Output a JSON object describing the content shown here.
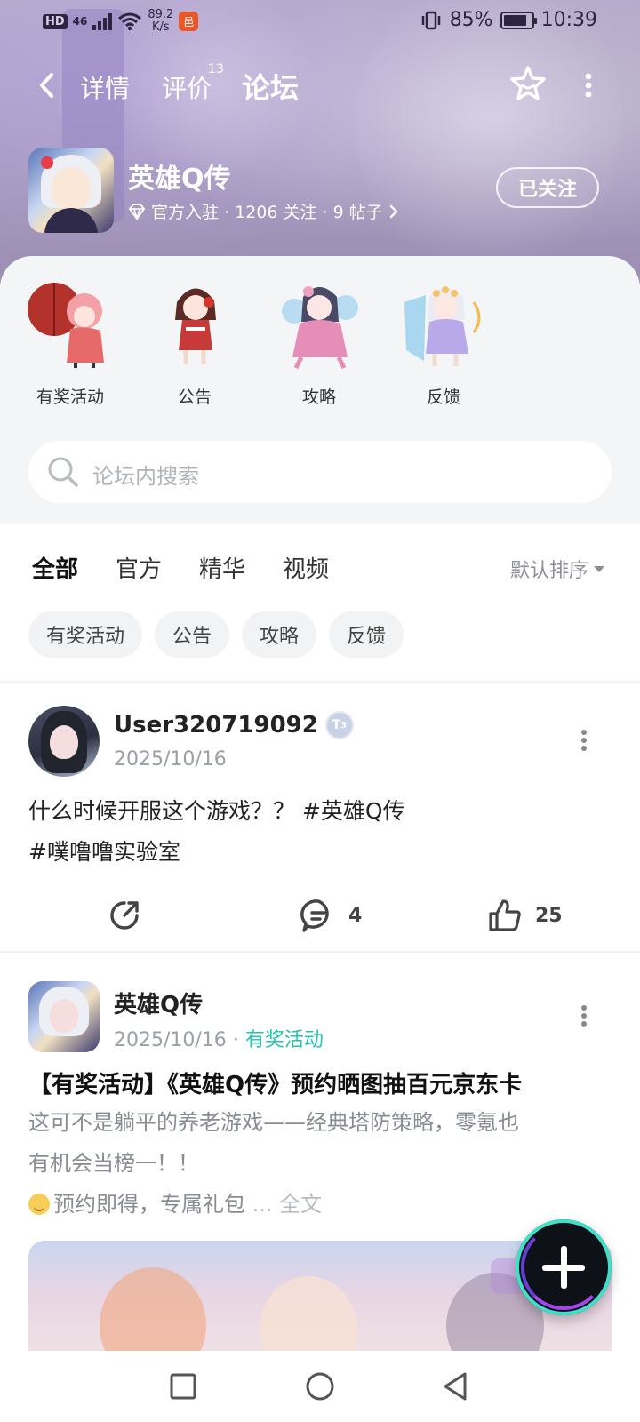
{
  "status_bar": {
    "network_type": "HD",
    "signal_label": "46",
    "speed_value": "89.2",
    "speed_unit": "K/s",
    "battery": "85%",
    "battery_level": 0.85,
    "time": "10:39"
  },
  "nav": {
    "tabs": [
      {
        "label": "详情"
      },
      {
        "label": "评价",
        "count": "13"
      },
      {
        "label": "论坛"
      }
    ],
    "active_tab": "论坛"
  },
  "game": {
    "title": "英雄Q传",
    "meta": "官方入驻 · 1206 关注 · 9 帖子",
    "follow_label": "已关注"
  },
  "quick_links": [
    {
      "label": "有奖活动"
    },
    {
      "label": "公告"
    },
    {
      "label": "攻略"
    },
    {
      "label": "反馈"
    }
  ],
  "search": {
    "placeholder": "论坛内搜索"
  },
  "filter_tabs": [
    {
      "label": "全部"
    },
    {
      "label": "官方"
    },
    {
      "label": "精华"
    },
    {
      "label": "视频"
    }
  ],
  "sort_label": "默认排序",
  "chips": [
    {
      "label": "有奖活动"
    },
    {
      "label": "公告"
    },
    {
      "label": "攻略"
    },
    {
      "label": "反馈"
    }
  ],
  "posts": [
    {
      "author": "User320719092",
      "level": "3",
      "date": "2025/10/16",
      "content_line1": "什么时候开服这个游戏？？ #英雄Q传",
      "content_line2": "#噗噜噜实验室",
      "comments": "4",
      "likes": "25"
    },
    {
      "author": "英雄Q传",
      "date": "2025/10/16",
      "separator": "·",
      "tag": "有奖活动",
      "title": "【有奖活动】《英雄Q传》预约晒图抽百元京东卡",
      "body_line1": "这可不是躺平的养老游戏——经典塔防策略，零氪也",
      "body_line2": "有机会当榜一！！",
      "body_line3": "预约即得，专属礼包",
      "more_label": "... 全文"
    }
  ],
  "colors": {
    "accent": "#3fe0c9",
    "tag_green": "#23c3ad",
    "hero_bg": "#a79bbf"
  }
}
